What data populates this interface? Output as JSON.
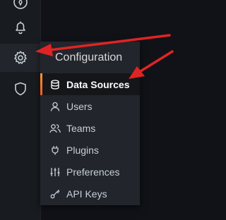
{
  "colors": {
    "sidebar_bg": "#181b1f",
    "menu_bg": "#22252b",
    "active_item_bg": "#141619",
    "active_indicator": "#ff9830",
    "annotation_arrow": "#e02424"
  },
  "sidebar": {
    "items": [
      {
        "icon": "compass-icon"
      },
      {
        "icon": "bell-icon"
      },
      {
        "icon": "gear-icon",
        "active": true
      },
      {
        "icon": "shield-icon"
      }
    ]
  },
  "menu": {
    "header": "Configuration",
    "items": [
      {
        "label": "Data Sources",
        "icon": "database-icon",
        "active": true
      },
      {
        "label": "Users",
        "icon": "user-icon"
      },
      {
        "label": "Teams",
        "icon": "users-icon"
      },
      {
        "label": "Plugins",
        "icon": "plug-icon"
      },
      {
        "label": "Preferences",
        "icon": "sliders-icon"
      },
      {
        "label": "API Keys",
        "icon": "key-icon"
      }
    ]
  }
}
